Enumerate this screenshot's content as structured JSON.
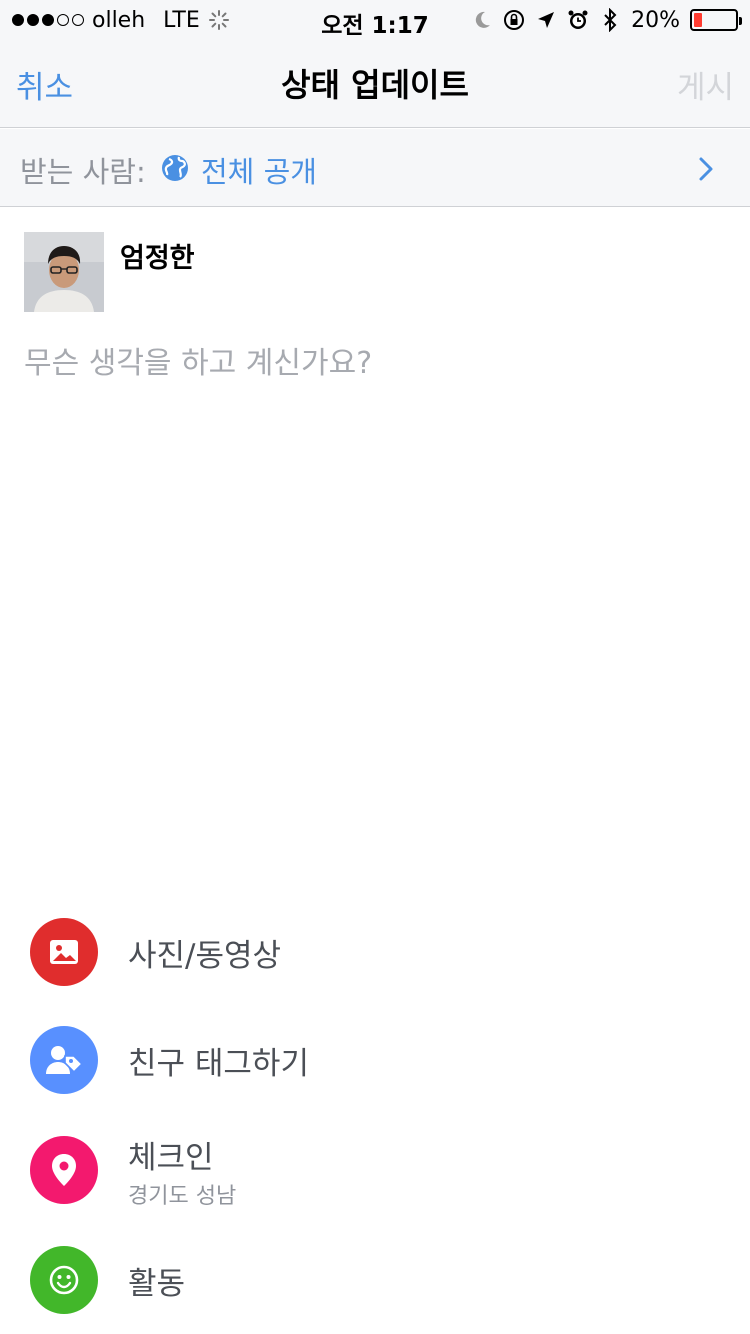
{
  "status_bar": {
    "carrier": "olleh",
    "network": "LTE",
    "time": "오전 1:17",
    "battery": "20%",
    "battery_level": 0.2,
    "signal_filled": 3,
    "signal_total": 5,
    "icons": [
      "moon-icon",
      "rotation-lock-icon",
      "location-arrow-icon",
      "alarm-icon",
      "bluetooth-icon",
      "battery-icon"
    ]
  },
  "nav": {
    "cancel": "취소",
    "title": "상태 업데이트",
    "post": "게시"
  },
  "audience": {
    "label": "받는 사람:",
    "value": "전체 공개",
    "icon": "globe-icon"
  },
  "composer": {
    "author_name": "엄정한",
    "placeholder": "무슨 생각을 하고 계신가요?"
  },
  "actions": [
    {
      "label": "사진/동영상",
      "icon": "photo-icon",
      "color": "#e02d2d"
    },
    {
      "label": "친구 태그하기",
      "icon": "tag-friends-icon",
      "color": "#5890ff"
    },
    {
      "label": "체크인",
      "sublabel": "경기도 성남",
      "icon": "location-pin-icon",
      "color": "#f3196e"
    },
    {
      "label": "활동",
      "icon": "smiley-icon",
      "color": "#42b72a"
    }
  ],
  "colors": {
    "accent": "#4a90e2",
    "disabled": "#d3d5d9",
    "bar_background": "#f6f7f9"
  }
}
